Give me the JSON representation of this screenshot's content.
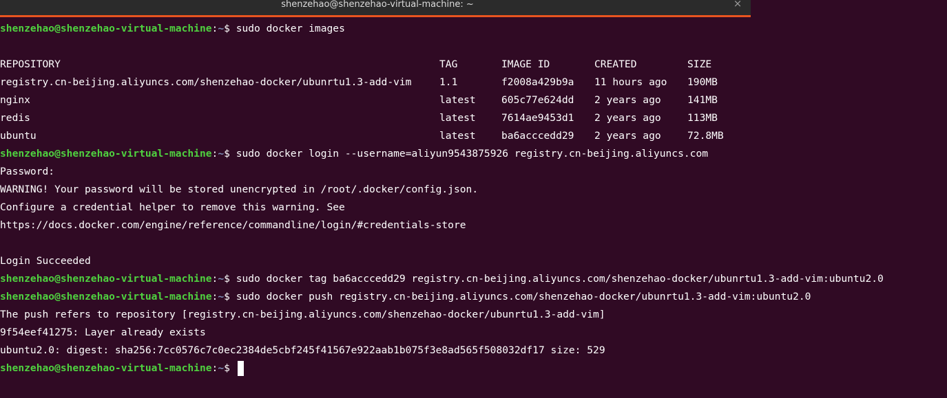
{
  "window": {
    "title": "shenzehao@shenzehao-virtual-machine: ~",
    "close_label": "×"
  },
  "prompt": {
    "user_host": "shenzehao@shenzehao-virtual-machine",
    "separator": ":",
    "path": "~",
    "symbol": "$ "
  },
  "commands": {
    "images": "sudo docker images",
    "login": "sudo docker login --username=aliyun9543875926 registry.cn-beijing.aliyuncs.com",
    "tag": "sudo docker tag ba6acccedd29 registry.cn-beijing.aliyuncs.com/shenzehao-docker/ubunrtu1.3-add-vim:ubuntu2.0",
    "push": "sudo docker push registry.cn-beijing.aliyuncs.com/shenzehao-docker/ubunrtu1.3-add-vim:ubuntu2.0"
  },
  "images_table": {
    "headers": {
      "repository": "REPOSITORY",
      "tag": "TAG",
      "image_id": "IMAGE ID",
      "created": "CREATED",
      "size": "SIZE"
    },
    "rows": [
      {
        "repository": "registry.cn-beijing.aliyuncs.com/shenzehao-docker/ubunrtu1.3-add-vim",
        "tag": "1.1",
        "image_id": "f2008a429b9a",
        "created": "11 hours ago",
        "size": "190MB"
      },
      {
        "repository": "nginx",
        "tag": "latest",
        "image_id": "605c77e624dd",
        "created": "2 years ago",
        "size": "141MB"
      },
      {
        "repository": "redis",
        "tag": "latest",
        "image_id": "7614ae9453d1",
        "created": "2 years ago",
        "size": "113MB"
      },
      {
        "repository": "ubuntu",
        "tag": "latest",
        "image_id": "ba6acccedd29",
        "created": "2 years ago",
        "size": "72.8MB"
      }
    ]
  },
  "login_output": {
    "password": "Password:",
    "warning": "WARNING! Your password will be stored unencrypted in /root/.docker/config.json.",
    "configure": "Configure a credential helper to remove this warning. See",
    "url": "https://docs.docker.com/engine/reference/commandline/login/#credentials-store",
    "succeeded": "Login Succeeded"
  },
  "push_output": {
    "refers": "The push refers to repository [registry.cn-beijing.aliyuncs.com/shenzehao-docker/ubunrtu1.3-add-vim]",
    "layer": "9f54eef41275: Layer already exists",
    "digest": "ubuntu2.0: digest: sha256:7cc0576c7c0ec2384de5cbf245f41567e922aab1b075f3e8ad565f508032df17 size: 529"
  }
}
